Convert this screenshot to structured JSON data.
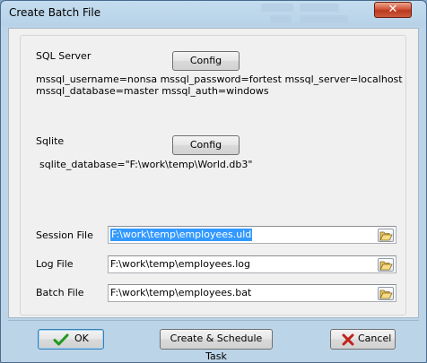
{
  "window": {
    "title": "Create Batch File",
    "close_glyph": "✕"
  },
  "sql_server": {
    "label": "SQL Server",
    "config_label": "Config",
    "summary_line1": "mssql_username=nonsa mssql_password=fortest mssql_server=localhost",
    "summary_line2": "mssql_database=master mssql_auth=windows"
  },
  "sqlite": {
    "label": "Sqlite",
    "config_label": "Config",
    "summary": "sqlite_database=\"F:\\work\\temp\\World.db3\""
  },
  "files": [
    {
      "label": "Session File",
      "value": "F:\\work\\temp\\employees.uld",
      "selected": true,
      "icon": "folder-open-icon"
    },
    {
      "label": "Log File",
      "value": "F:\\work\\temp\\employees.log",
      "selected": false,
      "icon": "folder-open-icon"
    },
    {
      "label": "Batch File",
      "value": "F:\\work\\temp\\employees.bat",
      "selected": false,
      "icon": "folder-open-icon"
    }
  ],
  "footer": {
    "ok_label": "OK",
    "ok_icon": "checkmark-icon",
    "schedule_label": "Create & Schedule Task",
    "cancel_label": "Cancel",
    "cancel_icon": "cross-icon"
  },
  "colors": {
    "selection": "#3399ff",
    "ok_check": "#1f9a1f",
    "cancel_cross": "#c0231a",
    "close_button": "#c9472b"
  }
}
